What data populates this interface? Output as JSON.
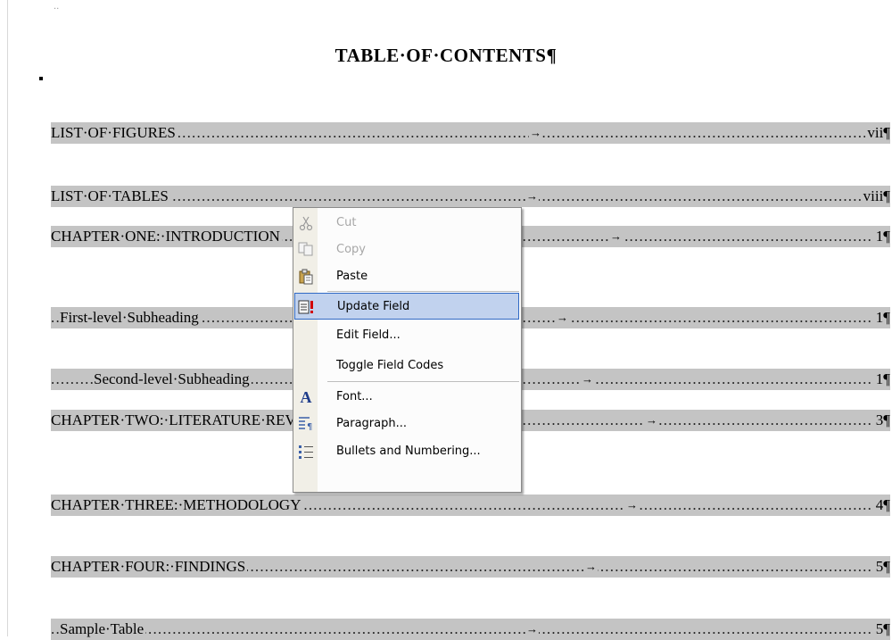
{
  "document": {
    "title": "TABLE·OF·CONTENTS¶",
    "corner_mark": "..",
    "toc": [
      {
        "text": "LIST·OF·FIGURES",
        "page": "vii¶"
      },
      {
        "text": "LIST·OF·TABLES",
        "page": "viii¶"
      },
      {
        "text": "CHAPTER·ONE:·INTRODUCTION",
        "page": "1¶"
      },
      {
        "text": "First-level·Subheading",
        "page": "1¶"
      },
      {
        "text": "Second-level·Subheading",
        "page": "1¶"
      },
      {
        "text": "CHAPTER·TWO:·LITERATURE·REVIEW",
        "page": "3¶"
      },
      {
        "text": "CHAPTER·THREE:·METHODOLOGY",
        "page": "4¶"
      },
      {
        "text": "CHAPTER·FOUR:·FINDINGS",
        "page": "5¶"
      },
      {
        "text": "Sample·Table",
        "page": "5¶"
      }
    ],
    "tab_arrow": "→",
    "leader_dots": "................................................................................................................................................................................................................................................"
  },
  "context_menu": {
    "items": [
      {
        "label": "Cut",
        "icon": "scissors-icon",
        "enabled": false
      },
      {
        "label": "Copy",
        "icon": "copy-icon",
        "enabled": false
      },
      {
        "label": "Paste",
        "icon": "paste-icon",
        "enabled": true
      },
      {
        "label": "Update Field",
        "icon": "update-field-icon",
        "enabled": true,
        "highlighted": true
      },
      {
        "label": "Edit Field...",
        "icon": "",
        "enabled": true
      },
      {
        "label": "Toggle Field Codes",
        "icon": "",
        "enabled": true
      },
      {
        "label": "Font...",
        "icon": "font-icon",
        "enabled": true
      },
      {
        "label": "Paragraph...",
        "icon": "paragraph-icon",
        "enabled": true
      },
      {
        "label": "Bullets and Numbering...",
        "icon": "bullets-icon",
        "enabled": true
      }
    ],
    "icon_glyphs": {
      "font": "A"
    }
  },
  "colors": {
    "field_shading": "#c4c4c4",
    "menu_highlight": "#c1d2ee",
    "menu_highlight_border": "#316ac5"
  }
}
